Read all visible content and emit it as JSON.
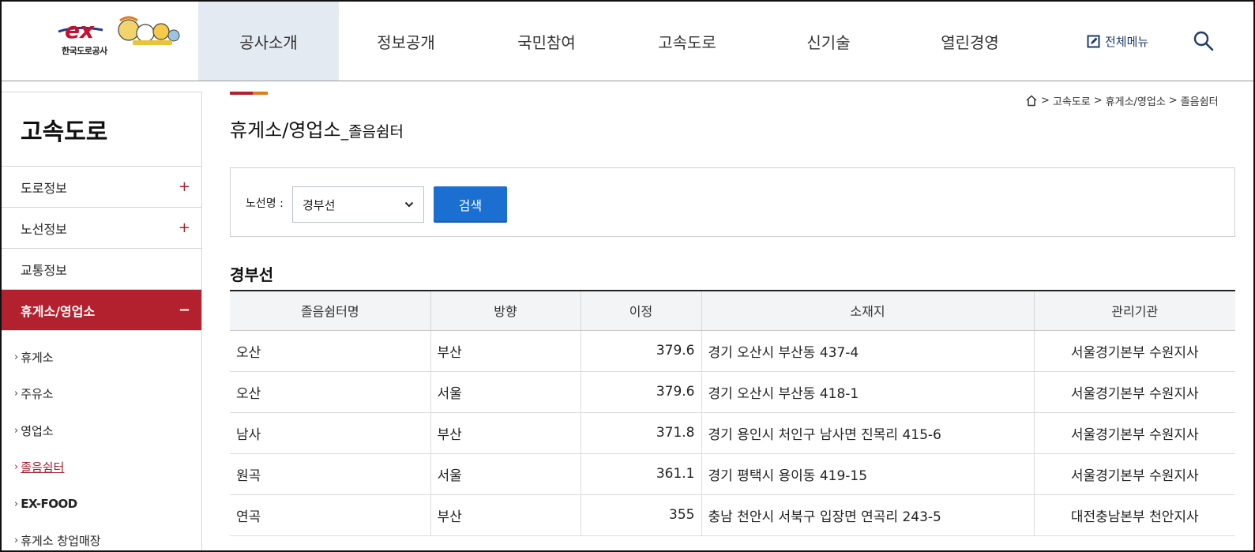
{
  "header": {
    "logo_text": "한국도로공사",
    "logo_mark": "ex",
    "nav": [
      {
        "label": "공사소개",
        "active": true
      },
      {
        "label": "정보공개",
        "active": false
      },
      {
        "label": "국민참여",
        "active": false
      },
      {
        "label": "고속도로",
        "active": false
      },
      {
        "label": "신기술",
        "active": false
      },
      {
        "label": "열린경영",
        "active": false
      }
    ],
    "all_menu_label": "전체메뉴",
    "icons": {
      "all_menu": "edit-box-icon",
      "search": "search-icon"
    }
  },
  "sidebar": {
    "title": "고속도로",
    "items": [
      {
        "label": "도로정보",
        "toggle": "+"
      },
      {
        "label": "노선정보",
        "toggle": "+"
      },
      {
        "label": "교통정보",
        "toggle": ""
      },
      {
        "label": "휴게소/영업소",
        "toggle": "−"
      }
    ],
    "sub_items": [
      {
        "label": "휴게소"
      },
      {
        "label": "주유소"
      },
      {
        "label": "영업소"
      },
      {
        "label": "졸음쉼터"
      },
      {
        "label": "EX-FOOD"
      },
      {
        "label": "휴게소 창업매장"
      }
    ]
  },
  "breadcrumb": {
    "items": [
      "고속도로",
      "휴게소/영업소",
      "졸음쉼터"
    ],
    "separator": ">"
  },
  "page": {
    "title_main": "휴게소/영업소",
    "title_sub": "_졸음쉼터"
  },
  "search": {
    "label": "노선명 :",
    "selected": "경부선",
    "button": "검색"
  },
  "section_title": "경부선",
  "table": {
    "headers": [
      "졸음쉼터명",
      "방향",
      "이정",
      "소재지",
      "관리기관"
    ],
    "rows": [
      [
        "오산",
        "부산",
        "379.6",
        "경기 오산시 부산동 437-4",
        "서울경기본부 수원지사"
      ],
      [
        "오산",
        "서울",
        "379.6",
        "경기 오산시 부산동 418-1",
        "서울경기본부 수원지사"
      ],
      [
        "남사",
        "부산",
        "371.8",
        "경기 용인시 처인구 남사면 진목리 415-6",
        "서울경기본부 수원지사"
      ],
      [
        "원곡",
        "서울",
        "361.1",
        "경기 평택시 용이동 419-15",
        "서울경기본부 수원지사"
      ],
      [
        "연곡",
        "부산",
        "355",
        "충남 천안시 서북구 입장면 연곡리 243-5",
        "대전충남본부 천안지사"
      ]
    ]
  },
  "colors": {
    "brand_red": "#b3202e",
    "accent_orange": "#e07b1d",
    "button_blue": "#1a6fd1",
    "nav_active_bg": "#e4eaf1"
  }
}
